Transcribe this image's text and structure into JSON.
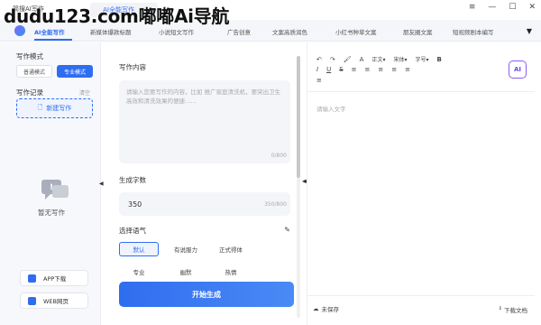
{
  "window": {
    "app_title": "简搜AI写作",
    "tab": "AI全能写作",
    "controls": [
      "≡",
      "—",
      "☐",
      "✕"
    ]
  },
  "watermark": "dudu123.com嘟嘟Ai导航",
  "nav": {
    "tabs": [
      "AI全能写作",
      "新媒体爆款标题",
      "小说短文写作",
      "广告创意",
      "文案高质润色",
      "小红书种草文案",
      "朋友圈文案",
      "短视频剧本编写"
    ],
    "more": "▼"
  },
  "sidebar": {
    "mode_label": "写作模式",
    "mode_normal": "普通模式",
    "mode_pro": "专业模式",
    "history_label": "写作记录",
    "clear": "清空",
    "new_write": "新建写作",
    "empty_text": "暂无写作",
    "app_download": "APP下载",
    "web": "WEB网页",
    "collapse": "◀"
  },
  "middle": {
    "content_label": "写作内容",
    "content_placeholder": "请输入您要写作的内容，比如 推广家庭清洗机，要突出卫生高效和清洗效果的便捷……",
    "content_counter": "0/800",
    "words_label": "生成字数",
    "words_value": "350",
    "words_counter": "350/800",
    "tone_label": "选择语气",
    "tones": [
      "默认",
      "有说服力",
      "正式得体",
      "专业",
      "幽默",
      "热情"
    ],
    "generate": "开始生成"
  },
  "editor": {
    "toolbar1": [
      "↶",
      "↷",
      "🖌",
      "A",
      "正文",
      "宋体",
      "字号",
      "B"
    ],
    "toolbar2": [
      "I",
      "U",
      "S",
      "≡",
      "≡",
      "≡",
      "≡",
      "≡"
    ],
    "toolbar3": [
      "≡"
    ],
    "ai": "AI",
    "placeholder": "请输入文字",
    "unsaved": "未保存",
    "download": "下载文档"
  }
}
